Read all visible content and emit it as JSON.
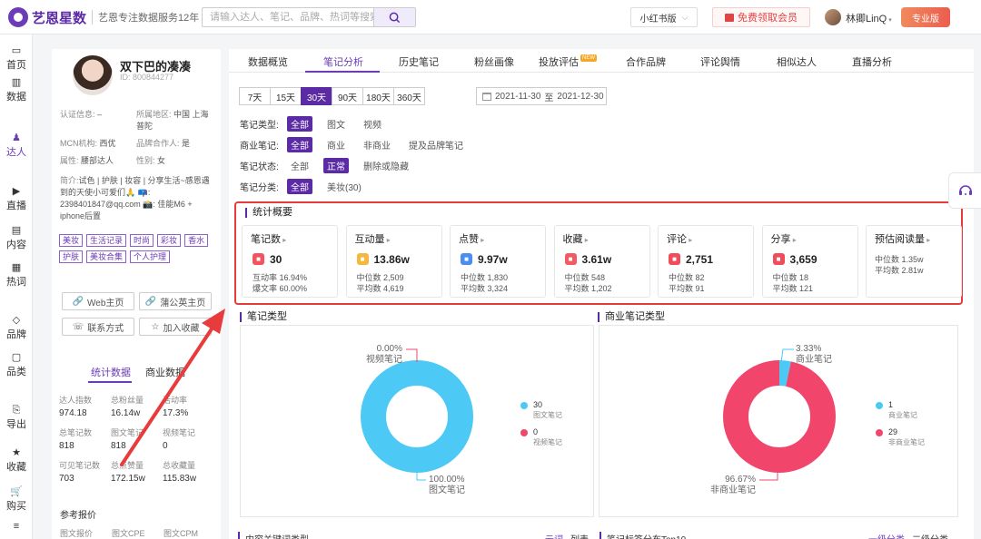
{
  "brand": {
    "name": "艺恩星数",
    "slogan": "艺恩专注数据服务12年"
  },
  "search": {
    "placeholder": "请输入达人、笔记、品牌、热词等搜索"
  },
  "header": {
    "platform": "小红书版",
    "member": "免费领取会员",
    "user": "林卿LinQ",
    "pro": "专业版"
  },
  "nav": [
    {
      "label": "首页",
      "icon": "home-icon"
    },
    {
      "label": "数据",
      "icon": "chart-icon"
    },
    {
      "label": "达人",
      "icon": "person-icon"
    },
    {
      "label": "直播",
      "icon": "play-icon"
    },
    {
      "label": "内容",
      "icon": "document-icon"
    },
    {
      "label": "热词",
      "icon": "trend-icon"
    },
    {
      "label": "品牌",
      "icon": "diamond-icon"
    },
    {
      "label": "品类",
      "icon": "box-icon"
    },
    {
      "label": "导出",
      "icon": "export-icon"
    },
    {
      "label": "收藏",
      "icon": "star-icon"
    },
    {
      "label": "购买",
      "icon": "cart-icon"
    }
  ],
  "profile": {
    "name": "双下巴的凑凑",
    "id": "ID: 800844277",
    "auth_k": "认证信息:",
    "auth_v": "–",
    "region_k": "所属地区:",
    "region_v": "中国 上海 普陀",
    "mcn_k": "MCN机构:",
    "mcn_v": "西优",
    "partner_k": "品牌合作人:",
    "partner_v": "是",
    "attr_k": "属性:",
    "attr_v": "腰部达人",
    "gender_k": "性别:",
    "gender_v": "女",
    "intro_k": "简介:",
    "intro_v": "试色 | 护肤 | 妆容 | 分享生活~感恩遇到的天使小可爱们🙏 📪: 2398401847@qq.com 📸: 佳能M6 + iphone后置",
    "tags": [
      "美妆",
      "生活记录",
      "时尚",
      "彩妆",
      "香水",
      "护肤",
      "美妆合集",
      "个人护理"
    ],
    "btn_web": "Web主页",
    "btn_pugong": "蒲公英主页",
    "btn_contact": "联系方式",
    "btn_fav": "加入收藏",
    "tab_stats": "统计数据",
    "tab_biz": "商业数据",
    "stats": [
      {
        "k": "达人指数",
        "v": "974.18"
      },
      {
        "k": "总粉丝量",
        "v": "16.14w"
      },
      {
        "k": "活动率",
        "v": "17.3%"
      },
      {
        "k": "总笔记数",
        "v": "818"
      },
      {
        "k": "图文笔记",
        "v": "818"
      },
      {
        "k": "视频笔记",
        "v": "0"
      },
      {
        "k": "可见笔记数",
        "v": "703"
      },
      {
        "k": "总点赞量",
        "v": "172.15w"
      },
      {
        "k": "总收藏量",
        "v": "115.83w"
      }
    ],
    "quote_title": "参考报价",
    "quote": [
      "图文报价",
      "图文CPE",
      "图文CPM"
    ]
  },
  "tabs": [
    {
      "label": "数据概览"
    },
    {
      "label": "笔记分析"
    },
    {
      "label": "历史笔记"
    },
    {
      "label": "粉丝画像"
    },
    {
      "label": "投放评估",
      "badge": "NEW"
    },
    {
      "label": "合作品牌"
    },
    {
      "label": "评论舆情"
    },
    {
      "label": "相似达人"
    },
    {
      "label": "直播分析"
    }
  ],
  "periods": [
    "7天",
    "15天",
    "30天",
    "90天",
    "180天",
    "360天"
  ],
  "date_range": {
    "start": "2021-11-30",
    "sep": "至",
    "end": "2021-12-30"
  },
  "filters": [
    {
      "label": "笔记类型:",
      "options": [
        "全部",
        "图文",
        "视频"
      ]
    },
    {
      "label": "商业笔记:",
      "options": [
        "全部",
        "商业",
        "非商业",
        "提及品牌笔记"
      ]
    },
    {
      "label": "笔记状态:",
      "options": [
        "全部",
        "正常",
        "删除或隐藏"
      ]
    },
    {
      "label": "笔记分类:",
      "options": [
        "全部",
        "美妆(30)"
      ]
    }
  ],
  "stats_title": "统计概要",
  "stat_cards": [
    {
      "title": "笔记数",
      "value": "30",
      "color": "#f2555f",
      "icon": "note-icon",
      "subs": [
        "互动率 16.94%",
        "爆文率 60.00%"
      ]
    },
    {
      "title": "互动量",
      "value": "13.86w",
      "color": "#f5b83d",
      "icon": "interaction-icon",
      "subs": [
        "中位数 2,509",
        "平均数 4,619"
      ]
    },
    {
      "title": "点赞",
      "value": "9.97w",
      "color": "#4a8ff0",
      "icon": "thumbs-up-icon",
      "subs": [
        "中位数 1,830",
        "平均数 3,324"
      ]
    },
    {
      "title": "收藏",
      "value": "3.61w",
      "color": "#f25a64",
      "icon": "collect-icon",
      "subs": [
        "中位数 548",
        "平均数 1,202"
      ]
    },
    {
      "title": "评论",
      "value": "2,751",
      "color": "#f04c5c",
      "icon": "comment-icon",
      "subs": [
        "中位数 82",
        "平均数 91"
      ]
    },
    {
      "title": "分享",
      "value": "3,659",
      "color": "#f04c5c",
      "icon": "share-icon",
      "subs": [
        "中位数 18",
        "平均数 121"
      ]
    },
    {
      "title": "预估阅读量",
      "value": "",
      "color": "",
      "icon": "",
      "subs": [
        "中位数 1.35w",
        "平均数 2.81w"
      ]
    }
  ],
  "note_type": {
    "title": "笔记类型",
    "top_pct": "0.00%",
    "top_name": "视频笔记",
    "bottom_pct": "100.00%",
    "bottom_name": "图文笔记",
    "legend": [
      {
        "value": "30",
        "name": "图文笔记",
        "color": "#4cc9f5"
      },
      {
        "value": "0",
        "name": "视频笔记",
        "color": "#f2456b"
      }
    ]
  },
  "commercial_type": {
    "title": "商业笔记类型",
    "top_pct": "3.33%",
    "top_name": "商业笔记",
    "bottom_pct": "96.67%",
    "bottom_name": "非商业笔记",
    "legend": [
      {
        "value": "1",
        "name": "商业笔记",
        "color": "#4cc9f5"
      },
      {
        "value": "29",
        "name": "非商业笔记",
        "color": "#f2456b"
      }
    ]
  },
  "chart_data": [
    {
      "type": "pie",
      "title": "笔记类型",
      "categories": [
        "视频笔记",
        "图文笔记"
      ],
      "values": [
        0,
        30
      ],
      "percent": [
        0.0,
        100.0
      ]
    },
    {
      "type": "pie",
      "title": "商业笔记类型",
      "categories": [
        "商业笔记",
        "非商业笔记"
      ],
      "values": [
        1,
        29
      ],
      "percent": [
        3.33,
        96.67
      ]
    }
  ],
  "bottom": {
    "left_title": "内容关键词类型",
    "cloud": "云词",
    "list": "列表",
    "right_title": "笔记标签分布Top10",
    "level1": "一级分类",
    "level2": "二级分类"
  }
}
